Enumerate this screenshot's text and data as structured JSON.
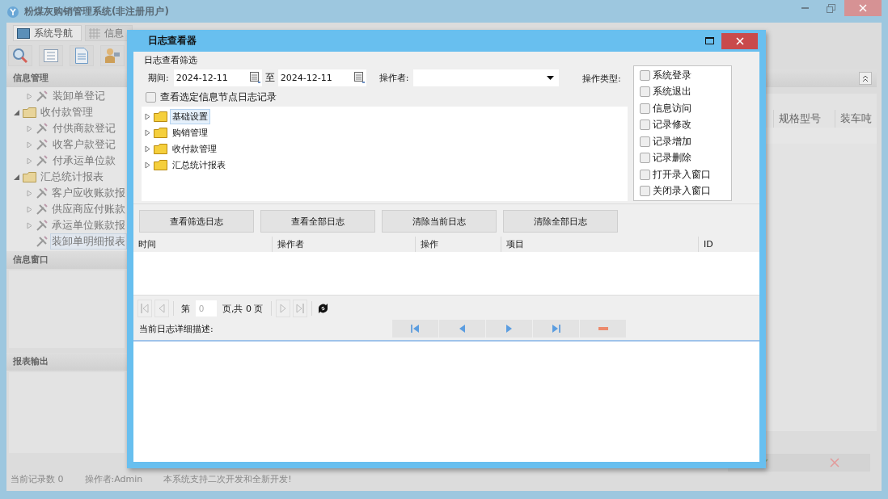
{
  "window": {
    "title": "粉煤灰购销管理系统(非注册用户)"
  },
  "tabs": [
    {
      "label": "系统导航",
      "selected": true
    },
    {
      "label": "信息",
      "selected": false
    }
  ],
  "sidebar": {
    "sections": [
      {
        "title": "信息管理",
        "tree": [
          {
            "label": "装卸单登记",
            "kind": "leaf",
            "expandable": true,
            "selected": false
          },
          {
            "label": "收付款管理",
            "kind": "folder",
            "expanded": true,
            "selected": false,
            "children": [
              {
                "label": "付供商款登记",
                "kind": "leaf",
                "expandable": true,
                "selected": false
              },
              {
                "label": "收客户款登记",
                "kind": "leaf",
                "expandable": true,
                "selected": false
              },
              {
                "label": "付承运单位款",
                "kind": "leaf",
                "expandable": true,
                "selected": false
              }
            ]
          },
          {
            "label": "汇总统计报表",
            "kind": "folder",
            "expanded": true,
            "selected": false,
            "children": [
              {
                "label": "客户应收账款报",
                "kind": "leaf",
                "expandable": true,
                "selected": false
              },
              {
                "label": "供应商应付账款",
                "kind": "leaf",
                "expandable": true,
                "selected": false
              },
              {
                "label": "承运单位账款报",
                "kind": "leaf",
                "expandable": true,
                "selected": false
              },
              {
                "label": "装卸单明细报表",
                "kind": "leaf",
                "expandable": false,
                "selected": true
              }
            ]
          }
        ]
      },
      {
        "title": "信息窗口"
      },
      {
        "title": "报表输出"
      }
    ]
  },
  "table": {
    "columns": [
      "规格型号",
      "装车吨"
    ]
  },
  "status_bar": [
    "当前记录数 0",
    "操作者:Admin",
    "本系统支持二次开发和全新开发!"
  ],
  "dialog": {
    "title": "日志查看器",
    "filter": {
      "title": "日志查看筛选",
      "period_label": "期间:",
      "from": "2024-12-11",
      "to_label": "至",
      "to": "2024-12-11",
      "operator_label": "操作者:",
      "type_label": "操作类型:",
      "types": [
        {
          "label": "系统登录",
          "checked": false
        },
        {
          "label": "系统退出",
          "checked": false
        },
        {
          "label": "信息访问",
          "checked": false
        },
        {
          "label": "记录修改",
          "checked": false
        },
        {
          "label": "记录增加",
          "checked": false
        },
        {
          "label": "记录删除",
          "checked": false
        },
        {
          "label": "打开录入窗口",
          "checked": false
        },
        {
          "label": "关闭录入窗口",
          "checked": false
        }
      ],
      "node_only": {
        "label": "查看选定信息节点日志记录",
        "checked": false
      }
    },
    "tree": [
      {
        "label": "基础设置",
        "selected": true
      },
      {
        "label": "购销管理",
        "selected": false
      },
      {
        "label": "收付款管理",
        "selected": false
      },
      {
        "label": "汇总统计报表",
        "selected": false
      }
    ],
    "buttons": [
      "查看筛选日志",
      "查看全部日志",
      "清除当前日志",
      "清除全部日志"
    ],
    "grid": {
      "columns": [
        "时间",
        "操作者",
        "操作",
        "项目",
        "ID"
      ]
    },
    "pager": {
      "page_label": "第",
      "page": "0",
      "total_label": "页,共 0 页"
    },
    "detail": {
      "label": "当前日志详细描述:"
    }
  }
}
